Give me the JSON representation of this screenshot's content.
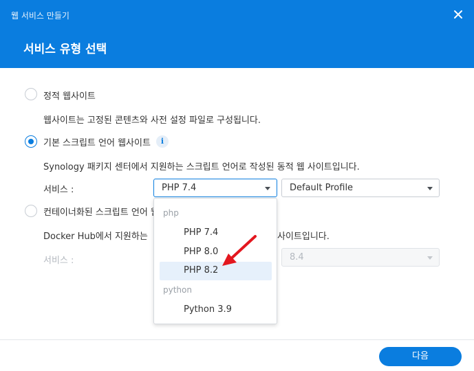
{
  "window": {
    "title": "웹 서비스 만들기",
    "close_icon": "close-icon"
  },
  "step": {
    "title": "서비스 유형 선택"
  },
  "options": [
    {
      "label": "정적 웹사이트",
      "selected": false,
      "description": "웹사이트는 고정된 콘텐츠와 사전 설정 파일로 구성됩니다."
    },
    {
      "label": "기본 스크립트 언어 웹사이트",
      "selected": true,
      "has_info": true,
      "description": "Synology 패키지 센터에서 지원하는 스크립트 언어로 작성된 동적 웹 사이트입니다."
    },
    {
      "label": "컨테이너화된 스크립트 언어 웹",
      "selected": false,
      "description_left": "Docker Hub에서 지원하는 ",
      "description_right": "사이트입니다."
    }
  ],
  "service_row": {
    "label": "서비스 :",
    "php_select": {
      "value": "PHP 7.4"
    },
    "profile_select": {
      "value": "Default Profile"
    }
  },
  "container_row": {
    "label": "서비스 :",
    "version_select": {
      "value": "8.4"
    }
  },
  "dropdown": {
    "groups": [
      {
        "label": "php",
        "items": [
          "PHP 7.4",
          "PHP 8.0",
          "PHP 8.2"
        ]
      },
      {
        "label": "python",
        "items": [
          "Python 3.9"
        ]
      }
    ],
    "highlighted": "PHP 8.2"
  },
  "footer": {
    "next_label": "다음"
  },
  "colors": {
    "accent": "#0a7ddf",
    "annotation": "#e3171f"
  }
}
